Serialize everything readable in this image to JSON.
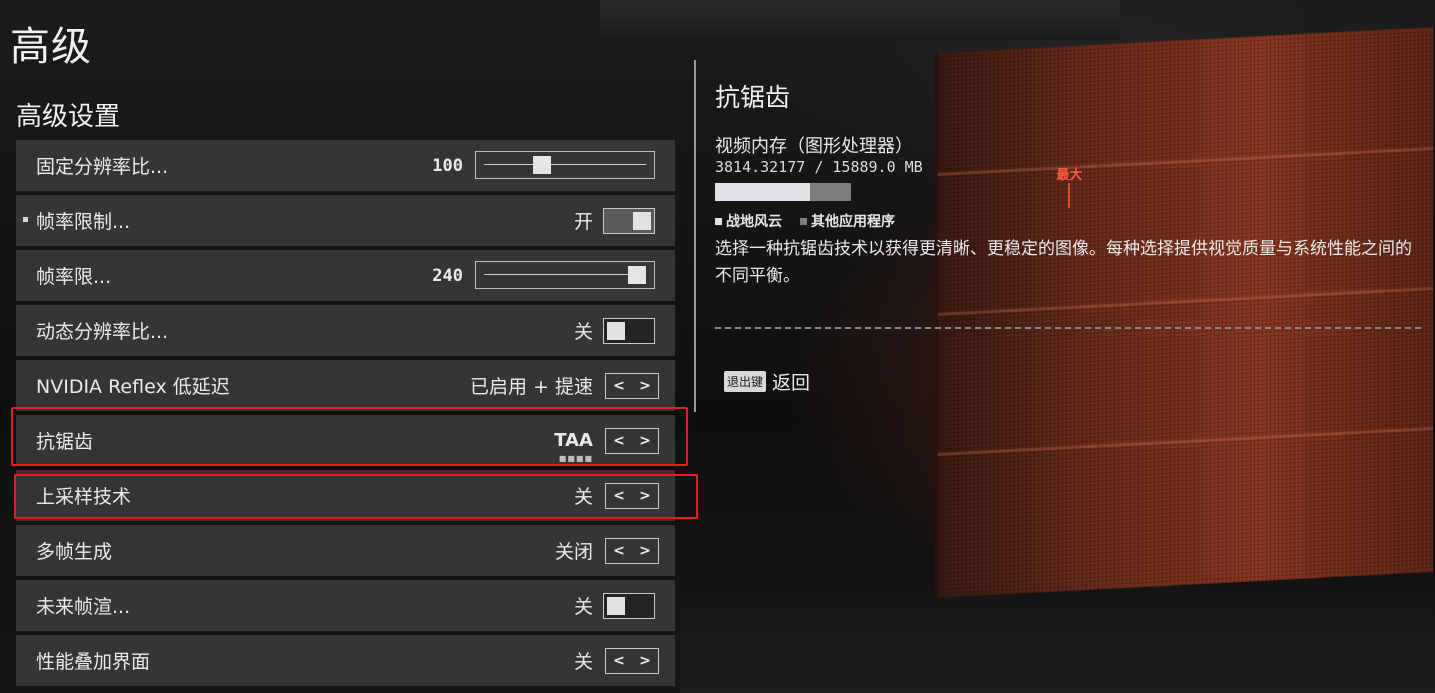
{
  "page": {
    "title": "高级"
  },
  "section": {
    "title": "高级设置"
  },
  "settings": [
    {
      "label": "固定分辨率比...",
      "value": "100",
      "control": "slider",
      "level_percent": 36
    },
    {
      "label": "帧率限制...",
      "value": "开",
      "control": "toggle",
      "state": "on",
      "bullet": true
    },
    {
      "label": "帧率限...",
      "value": "240",
      "control": "slider",
      "level_percent": 100
    },
    {
      "label": "动态分辨率比...",
      "value": "关",
      "control": "toggle",
      "state": "off"
    },
    {
      "label": "NVIDIA Reflex 低延迟",
      "value": "已启用 + 提速",
      "control": "selector"
    },
    {
      "label": "抗锯齿",
      "value": "TAA",
      "control": "selector",
      "selected": true,
      "dots": "■■■■"
    },
    {
      "label": "上采样技术",
      "value": "关",
      "control": "selector"
    },
    {
      "label": "多帧生成",
      "value": "关闭",
      "control": "selector"
    },
    {
      "label": "未来帧渲...",
      "value": "关",
      "control": "toggle",
      "state": "off"
    },
    {
      "label": "性能叠加界面",
      "value": "关",
      "control": "selector"
    }
  ],
  "arrows": {
    "left": "<",
    "right": ">"
  },
  "info": {
    "title": "抗锯齿",
    "vram": {
      "label": "视频内存（图形处理器）",
      "value": "3814.32177 / 15889.0 MB",
      "game_fraction": 0.134,
      "other_fraction": 0.058,
      "max_fraction": 0.502,
      "max_label": "最大",
      "legend": [
        {
          "label": "战地风云",
          "color": "#dfe3e8"
        },
        {
          "label": "其他应用程序",
          "color": "#7d7d7d"
        }
      ]
    },
    "description": "选择一种抗锯齿技术以获得更清晰、更稳定的图像。每种选择提供视觉质量与系统性能之间的不同平衡。"
  },
  "back": {
    "key": "退出键",
    "label": "返回"
  },
  "colors": {
    "highlight": "#e02020",
    "max_marker": "#ff5a3c"
  }
}
